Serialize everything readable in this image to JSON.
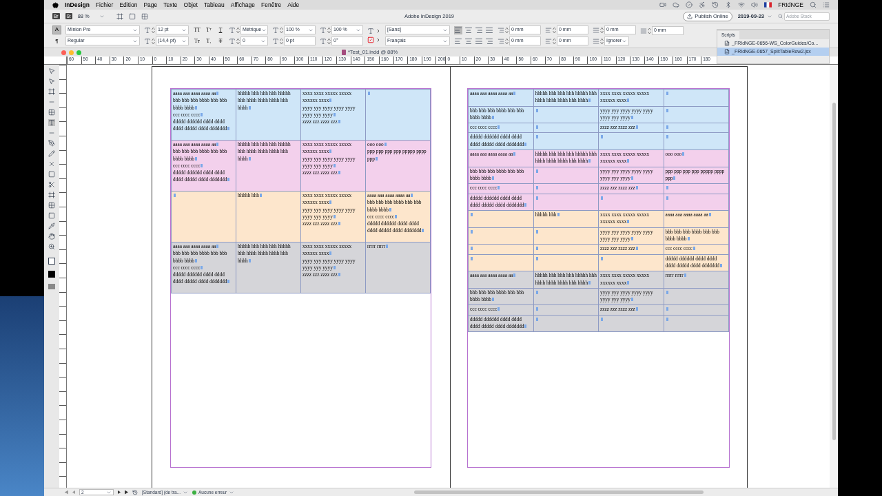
{
  "menu_bar": {
    "app": "InDesign",
    "items": [
      "Fichier",
      "Edition",
      "Page",
      "Texte",
      "Objet",
      "Tableau",
      "Affichage",
      "Fenêtre",
      "Aide"
    ],
    "user": "FRIdNGE"
  },
  "app_bar": {
    "bridge": "Br",
    "stock": "St",
    "zoom": "88 %",
    "title": "Adobe InDesign 2019",
    "publish": "Publish Online",
    "workspace": "2019-09-23",
    "search_placeholder": "Adobe Stock"
  },
  "control_panel": {
    "modes": [
      {
        "label": "A",
        "selected": true
      },
      {
        "label": "¶",
        "selected": false
      }
    ],
    "font": "Minion Pro",
    "style": "Regular",
    "size": "12 pt",
    "leading": "(14,4 pt)",
    "case_buttons": [
      {
        "label": "TT",
        "kind": "plain"
      },
      {
        "label": "Tᵀ",
        "kind": "plain"
      },
      {
        "label": "T",
        "kind": "underline"
      },
      {
        "label": "Tт",
        "kind": "plain"
      },
      {
        "label": "T₁",
        "kind": "plain"
      },
      {
        "label": "T",
        "kind": "strike"
      }
    ],
    "kerning": "Métrique",
    "tracking": "0",
    "vertical_scale": "100 %",
    "baseline_shift": "0 pt",
    "horizontal_scale": "100 %",
    "skew": "0°",
    "char_style": "[Sans]",
    "language": "Français",
    "alignments": [
      {
        "selected": true
      },
      {
        "selected": false
      },
      {
        "selected": false
      },
      {
        "selected": false
      },
      {
        "selected": false
      },
      {
        "selected": false
      },
      {
        "selected": false
      },
      {
        "selected": false
      }
    ],
    "left_indent": "0 mm",
    "first_line_indent": "0 mm",
    "right_indent": "0 mm",
    "last_line_indent": "0 mm",
    "space_before": "0 mm",
    "space_after": "0 mm",
    "grid_align": "Ignorer"
  },
  "document": {
    "title": "*Test_01.indd @ 88%"
  },
  "ruler": {
    "labels": [
      "60",
      "50",
      "40",
      "30",
      "20",
      "10",
      "0",
      "10",
      "20",
      "30",
      "40",
      "50",
      "60",
      "70",
      "80",
      "90",
      "100",
      "110",
      "120",
      "130",
      "140",
      "150",
      "160",
      "170",
      "180",
      "190",
      "200",
      "0",
      "10",
      "20",
      "30",
      "40",
      "50",
      "60",
      "70",
      "80",
      "90",
      "100",
      "110",
      "120",
      "130",
      "140",
      "150",
      "160",
      "170",
      "180"
    ]
  },
  "scripts_panel": {
    "tab": "Scripts",
    "items": [
      {
        "label": "_FRIdNGE-0656-WS_ColorGuides/Co...",
        "selected": false
      },
      {
        "label": "_FRIdNGE-0657_SplitTableRow2.jsx",
        "selected": true
      }
    ]
  },
  "left_table": {
    "rows": [
      {
        "color": "#cfe6f8",
        "cells": [
          [
            "aaaa aaa aaaa aaaa aa",
            "bbb bbb bbb bbbb bbb bbb bbbb bbbb",
            "ccc cccc cccc",
            "ddddd dddddd dddd dddd dddd ddddd dddd ddddddd"
          ],
          [
            "hhhhh hhh hhh hhh hhhhh hhh hhhh hhhh hhhh hhh hhhh"
          ],
          [
            "xxxx xxxx xxxxx xxxxx xxxxxx xxxx",
            "yyyy yyy yyyy yyyy yyyy yyyy yyy yyyy",
            "zzzz zzz zzzz zzz"
          ],
          []
        ]
      },
      {
        "color": "#f3d0ec",
        "cells": [
          [
            "aaaa aaa aaaa aaaa aa",
            "bbb bbb bbb bbbb bbb bbb bbbb bbbb",
            "ccc cccc cccc",
            "ddddd dddddd dddd dddd dddd ddddd dddd ddddddd"
          ],
          [
            "hhhhh hhh hhh hhh hhhhh hhh hhhh hhhh hhhh hhh hhhh"
          ],
          [
            "xxxx xxxx xxxxx xxxxx xxxxxx xxxx",
            "yyyy yyy yyyy yyyy yyyy yyyy yyy yyyy",
            "zzzz zzz zzzz zzz"
          ],
          [
            "ooo ooo",
            "ppp ppp ppp ppp ppppp pppp ppp"
          ]
        ]
      },
      {
        "color": "#fde6cc",
        "cells": [
          [],
          [
            "hhhhh hhh"
          ],
          [
            "xxxx xxxx xxxxx xxxxx xxxxxx xxxx",
            "yyyy yyy yyyy yyyy yyyy yyyy yyy yyyy",
            "zzzz zzz zzzz zzz"
          ],
          [
            "aaaa aaa aaaa aaaa aa",
            "bbb bbb bbb bbbb bbb bbb bbbb bbbb",
            "ccc cccc cccc",
            "ddddd dddddd dddd dddd dddd ddddd dddd ddddddd"
          ]
        ]
      },
      {
        "color": "#d5d5d9",
        "cells": [
          [
            "aaaa aaa aaaa aaaa aa",
            "bbb bbb bbb bbbb bbb bbb bbbb bbbb",
            "ccc cccc cccc",
            "ddddd dddddd dddd dddd dddd ddddd dddd ddddddd"
          ],
          [
            "hhhhh hhh hhh hhh hhhhh hhh hhhh hhhh hhhh hhh hhhh"
          ],
          [
            "xxxx xxxx xxxxx xxxxx xxxxxx xxxx",
            "yyyy yyy yyyy yyyy yyyy yyyy yyy yyyy",
            "zzzz zzz zzzz zzz"
          ],
          [
            "rrrrr rrrrr"
          ]
        ]
      }
    ]
  },
  "right_table": {
    "rows": [
      {
        "color": "#cfe6f8",
        "cells": [
          [
            "aaaa aaa aaaa aaaa aa"
          ],
          [
            "hhhhh hhh hhh hhh hhhhh hhh hhhh hhhh hhhh hhh hhhh"
          ],
          [
            "xxxx xxxx xxxxx xxxxx xxxxxx xxxx"
          ],
          []
        ]
      },
      {
        "color": "#cfe6f8",
        "cells": [
          [
            "bbb bbb bbb bbbb bbb bbb bbbb bbbb"
          ],
          [],
          [
            "yyyy yyy yyyy yyyy yyyy yyyy yyy yyyy"
          ],
          []
        ]
      },
      {
        "color": "#cfe6f8",
        "cells": [
          [
            "ccc cccc cccc"
          ],
          [],
          [
            "zzzz zzz zzzz zzz"
          ],
          []
        ]
      },
      {
        "color": "#cfe6f8",
        "cells": [
          [
            "ddddd dddddd dddd dddd dddd ddddd dddd ddddddd"
          ],
          [],
          [],
          []
        ]
      },
      {
        "color": "#f3d0ec",
        "cells": [
          [
            "aaaa aaa aaaa aaaa aa"
          ],
          [
            "hhhhh hhh hhh hhh hhhhh hhh hhhh hhhh hhhh hhh hhhh"
          ],
          [
            "xxxx xxxx xxxxx xxxxx xxxxxx xxxx"
          ],
          [
            "ooo ooo"
          ]
        ]
      },
      {
        "color": "#f3d0ec",
        "cells": [
          [
            "bbb bbb bbb bbbb bbb bbb bbbb bbbb"
          ],
          [],
          [
            "yyyy yyy yyyy yyyy yyyy yyyy yyy yyyy"
          ],
          [
            "ppp ppp ppp ppp ppppp pppp ppp"
          ]
        ]
      },
      {
        "color": "#f3d0ec",
        "cells": [
          [
            "ccc cccc cccc"
          ],
          [],
          [
            "zzzz zzz zzzz zzz"
          ],
          []
        ]
      },
      {
        "color": "#f3d0ec",
        "cells": [
          [
            "ddddd dddddd dddd dddd dddd ddddd dddd ddddddd"
          ],
          [],
          [],
          []
        ]
      },
      {
        "color": "#fde6cc",
        "cells": [
          [],
          [
            "hhhhh hhh"
          ],
          [
            "xxxx xxxx xxxxx xxxxx xxxxxx xxxx"
          ],
          [
            "aaaa aaa aaaa aaaa aa"
          ]
        ]
      },
      {
        "color": "#fde6cc",
        "cells": [
          [],
          [],
          [
            "yyyy yyy yyyy yyyy yyyy yyyy yyy yyyy"
          ],
          [
            "bbb bbb bbb bbbb bbb bbb bbbb bbbb"
          ]
        ]
      },
      {
        "color": "#fde6cc",
        "cells": [
          [],
          [],
          [
            "zzzz zzz zzzz zzz"
          ],
          [
            "ccc cccc cccc"
          ]
        ]
      },
      {
        "color": "#fde6cc",
        "cells": [
          [],
          [],
          [],
          [
            "ddddd dddddd dddd dddd dddd ddddd dddd ddddddd"
          ]
        ]
      },
      {
        "color": "#d5d5d9",
        "cells": [
          [
            "aaaa aaa aaaa aaaa aa"
          ],
          [
            "hhhhh hhh hhh hhh hhhhh hhh hhhh hhhh hhhh hhh hhhh"
          ],
          [
            "xxxx xxxx xxxxx xxxxx xxxxxx xxxx"
          ],
          [
            "rrrrr rrrrr"
          ]
        ]
      },
      {
        "color": "#d5d5d9",
        "cells": [
          [
            "bbb bbb bbb bbbb bbb bbb bbbb bbbb"
          ],
          [],
          [
            "yyyy yyy yyyy yyyy yyyy yyyy yyy yyyy"
          ],
          []
        ]
      },
      {
        "color": "#d5d5d9",
        "cells": [
          [
            "ccc cccc cccc"
          ],
          [],
          [
            "zzzz zzz zzzz zzz"
          ],
          []
        ]
      },
      {
        "color": "#d5d5d9",
        "cells": [
          [
            "ddddd dddddd dddd dddd dddd ddddd dddd ddddddd"
          ],
          [],
          [],
          []
        ]
      }
    ]
  },
  "status_bar": {
    "page": "2",
    "style": "[Standard] (de tra...",
    "preflight": "Aucune erreur"
  }
}
